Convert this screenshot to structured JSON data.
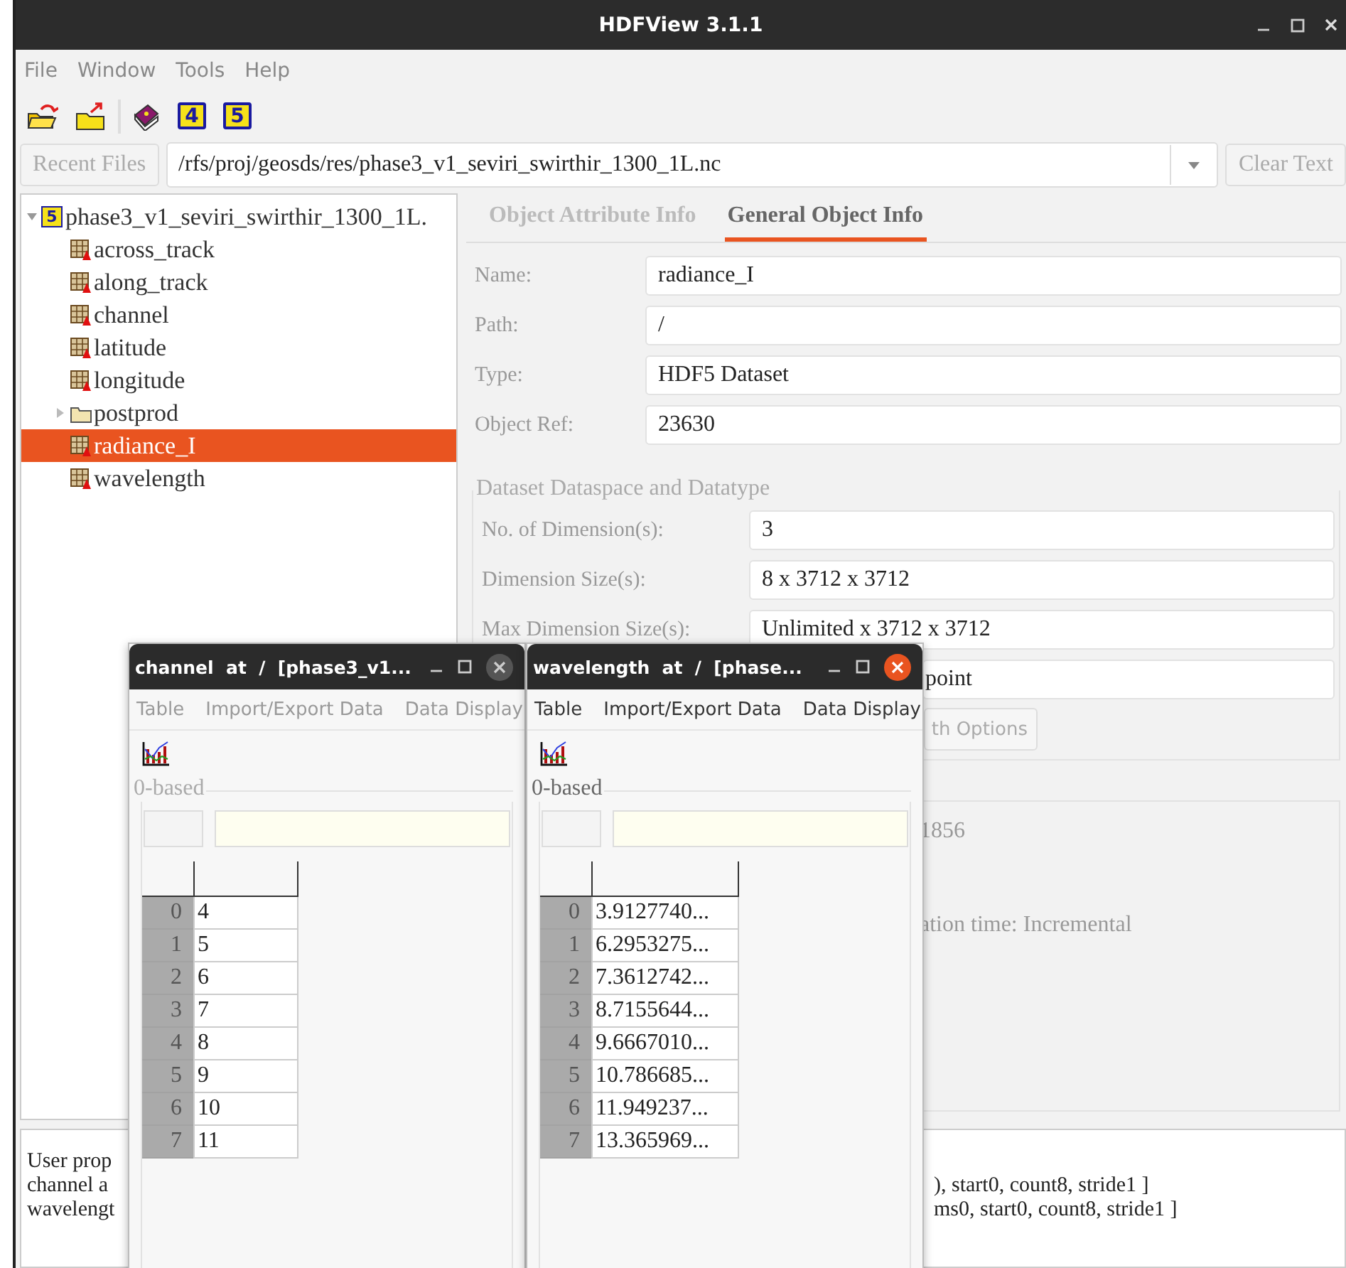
{
  "window": {
    "title": "HDFView 3.1.1"
  },
  "menu": [
    "File",
    "Window",
    "Tools",
    "Help"
  ],
  "toolbar_groups": [
    [
      {
        "kind": "open"
      },
      {
        "kind": "close"
      }
    ],
    [
      {
        "kind": "help"
      },
      {
        "kind": "numbered",
        "label": "4"
      },
      {
        "kind": "numbered",
        "label": "5"
      }
    ]
  ],
  "file_bar": {
    "recent_button": "Recent Files",
    "path": "/rfs/proj/geosds/res/phase3_v1_seviri_swirthir_1300_1L.nc",
    "clear_button": "Clear Text"
  },
  "tree": {
    "label": "phase3_v1_seviri_swirthir_1300_1L.",
    "badge": "5",
    "expanded": true,
    "children": [
      {
        "label": "across_track",
        "kind": "dataset",
        "selected": false
      },
      {
        "label": "along_track",
        "kind": "dataset",
        "selected": false
      },
      {
        "label": "channel",
        "kind": "dataset",
        "selected": false
      },
      {
        "label": "latitude",
        "kind": "dataset",
        "selected": false
      },
      {
        "label": "longitude",
        "kind": "dataset",
        "selected": false
      },
      {
        "label": "postprod",
        "kind": "group",
        "selected": false,
        "expanded": false
      },
      {
        "label": "radiance_I",
        "kind": "dataset",
        "selected": true
      },
      {
        "label": "wavelength",
        "kind": "dataset",
        "selected": false
      }
    ]
  },
  "info": {
    "tabs": [
      {
        "label": "Object Attribute Info",
        "selected": false
      },
      {
        "label": "General Object Info",
        "selected": true
      }
    ],
    "fields": [
      {
        "label": "Name:",
        "value": "radiance_I"
      },
      {
        "label": "Path:",
        "value": "/"
      },
      {
        "label": "Type:",
        "value": "HDF5 Dataset"
      },
      {
        "label": "Object Ref:",
        "value": "23630"
      }
    ],
    "dataspace": {
      "title": "Dataset Dataspace and Datatype",
      "fields": [
        {
          "label": "No. of Dimension(s):",
          "value": "3"
        },
        {
          "label": "Dimension Size(s):",
          "value": "8 x 3712 x 3712"
        },
        {
          "label": "Max Dimension Size(s):",
          "value": "Unlimited x 3712 x 3712"
        }
      ],
      "partial_value": "point",
      "button": "th Options"
    },
    "storage_texts": [
      "1856",
      "ation time: Incremental"
    ]
  },
  "log": [
    {
      "start": "User prop"
    },
    {
      "start": "channel  a",
      "end": "), start0, count8, stride1 ]"
    },
    {
      "start": "wavelengt",
      "end": "ms0, start0, count8, stride1 ]"
    }
  ],
  "data_windows": [
    {
      "title": "channel  at  /  [phase3_v1...",
      "active": false,
      "menu": [
        "Table",
        "Import/Export Data",
        "Data Display"
      ],
      "index_label": "0-based",
      "rows": [
        {
          "index": "0",
          "value": "4"
        },
        {
          "index": "1",
          "value": "5"
        },
        {
          "index": "2",
          "value": "6"
        },
        {
          "index": "3",
          "value": "7"
        },
        {
          "index": "4",
          "value": "8"
        },
        {
          "index": "5",
          "value": "9"
        },
        {
          "index": "6",
          "value": "10"
        },
        {
          "index": "7",
          "value": "11"
        }
      ]
    },
    {
      "title": "wavelength  at  /  [phase...",
      "active": true,
      "menu": [
        "Table",
        "Import/Export Data",
        "Data Display"
      ],
      "index_label": "0-based",
      "rows": [
        {
          "index": "0",
          "value": "3.9127740..."
        },
        {
          "index": "1",
          "value": "6.2953275..."
        },
        {
          "index": "2",
          "value": "7.3612742..."
        },
        {
          "index": "3",
          "value": "8.7155644..."
        },
        {
          "index": "4",
          "value": "9.6667010..."
        },
        {
          "index": "5",
          "value": "10.786685..."
        },
        {
          "index": "6",
          "value": "11.949237..."
        },
        {
          "index": "7",
          "value": "13.365969..."
        }
      ]
    }
  ]
}
